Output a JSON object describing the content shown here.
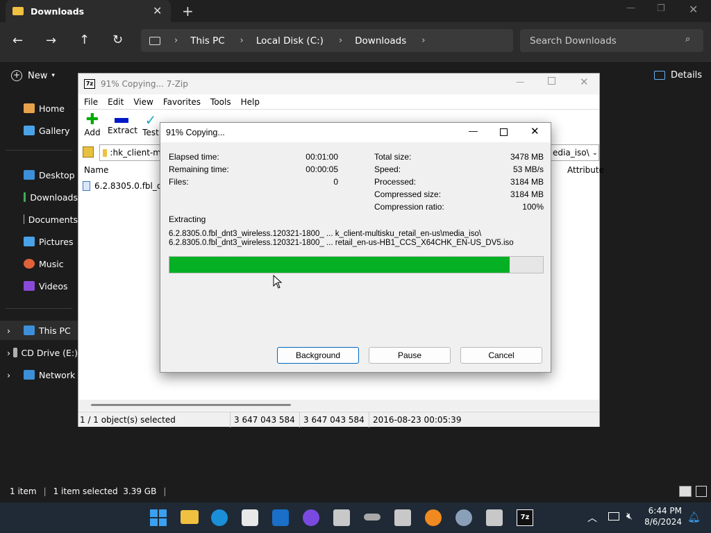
{
  "explorer": {
    "tab_title": "Downloads",
    "breadcrumb": [
      "This PC",
      "Local Disk (C:)",
      "Downloads"
    ],
    "search_placeholder": "Search Downloads",
    "new_label": "New",
    "details_label": "Details",
    "nav_items": [
      {
        "label": "Home",
        "icon": "home-icon",
        "color": "#e8a24a"
      },
      {
        "label": "Gallery",
        "icon": "gallery-icon",
        "color": "#4aa3e8"
      },
      {
        "label": "Desktop",
        "icon": "desktop-icon",
        "color": "#3c8fd8"
      },
      {
        "label": "Downloads",
        "icon": "download-icon",
        "color": "#3fae5a"
      },
      {
        "label": "Documents",
        "icon": "document-icon",
        "color": "#aab4c2"
      },
      {
        "label": "Pictures",
        "icon": "pictures-icon",
        "color": "#4aa3e8"
      },
      {
        "label": "Music",
        "icon": "music-icon",
        "color": "#e0623a"
      },
      {
        "label": "Videos",
        "icon": "videos-icon",
        "color": "#8a4ad8"
      },
      {
        "label": "This PC",
        "icon": "computer-icon",
        "color": "#3c8fd8"
      },
      {
        "label": "CD Drive (E:)",
        "icon": "cd-drive-icon",
        "color": "#b0b0b0"
      },
      {
        "label": "Network",
        "icon": "network-icon",
        "color": "#3c8fd8"
      }
    ],
    "status_items": "1 item",
    "status_selected": "1 item selected  3.39 GB"
  },
  "zip": {
    "title": "91% Copying... 7-Zip",
    "menu": [
      "File",
      "Edit",
      "View",
      "Favorites",
      "Tools",
      "Help"
    ],
    "toolbar": [
      "Add",
      "Extract",
      "Test"
    ],
    "path_left": ":hk_client-m",
    "path_right": "edia_iso\\",
    "col_name": "Name",
    "col_attr": "Attribute",
    "file": "6.2.8305.0.fbl_dnt3",
    "status": [
      "1 / 1 object(s) selected",
      "3 647 043 584",
      "3 647 043 584",
      "2016-08-23 00:05:39"
    ]
  },
  "dialog": {
    "title": "91% Copying...",
    "left": [
      {
        "label": "Elapsed time:",
        "value": "00:01:00"
      },
      {
        "label": "Remaining time:",
        "value": "00:00:05"
      },
      {
        "label": "Files:",
        "value": "0"
      }
    ],
    "right": [
      {
        "label": "Total size:",
        "value": "3478 MB"
      },
      {
        "label": "Speed:",
        "value": "53 MB/s"
      },
      {
        "label": "Processed:",
        "value": "3184 MB"
      },
      {
        "label": "Compressed size:",
        "value": "3184 MB"
      },
      {
        "label": "Compression ratio:",
        "value": "100%"
      }
    ],
    "operation": "Extracting",
    "path1": "6.2.8305.0.fbl_dnt3_wireless.120321-1800_ ... k_client-multisku_retail_en-us\\media_iso\\",
    "path2": "6.2.8305.0.fbl_dnt3_wireless.120321-1800_ ... retail_en-us-HB1_CCS_X64CHK_EN-US_DV5.iso",
    "progress": 0.91,
    "buttons": {
      "background": "Background",
      "pause": "Pause",
      "cancel": "Cancel"
    }
  },
  "taskbar": {
    "time": "6:44 PM",
    "date": "8/6/2024"
  },
  "colors": {
    "progress": "#06b025",
    "accent": "#0067c0"
  }
}
